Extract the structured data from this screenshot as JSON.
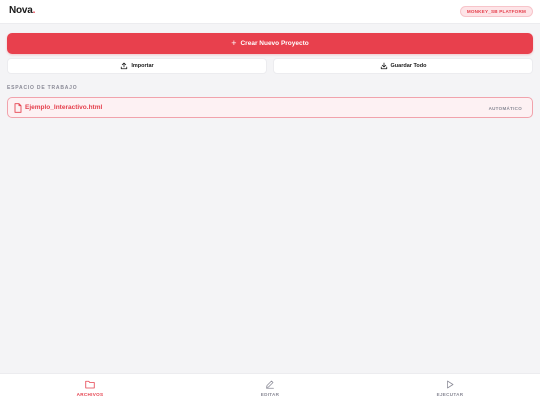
{
  "header": {
    "logo": "Nova",
    "logo_dot": ".",
    "platform_badge": "MONKEY_SB PLATFORM"
  },
  "actions": {
    "create_label": "Crear Nuevo Proyecto",
    "import_label": "Importar",
    "save_all_label": "Guardar Todo"
  },
  "workspace": {
    "section_label": "ESPACIO DE TRABAJO",
    "files": [
      {
        "name": "Ejemplo_Interactivo.html",
        "tag": "AUTOMÁTICO"
      }
    ]
  },
  "nav": {
    "items": [
      {
        "label": "ARCHIVOS",
        "icon": "folder-icon",
        "active": true
      },
      {
        "label": "EDITAR",
        "icon": "pencil-icon",
        "active": false
      },
      {
        "label": "EJECUTAR",
        "icon": "play-icon",
        "active": false
      }
    ]
  },
  "colors": {
    "accent": "#e5404d",
    "background": "#f4f4f6",
    "muted": "#8a8a96"
  }
}
